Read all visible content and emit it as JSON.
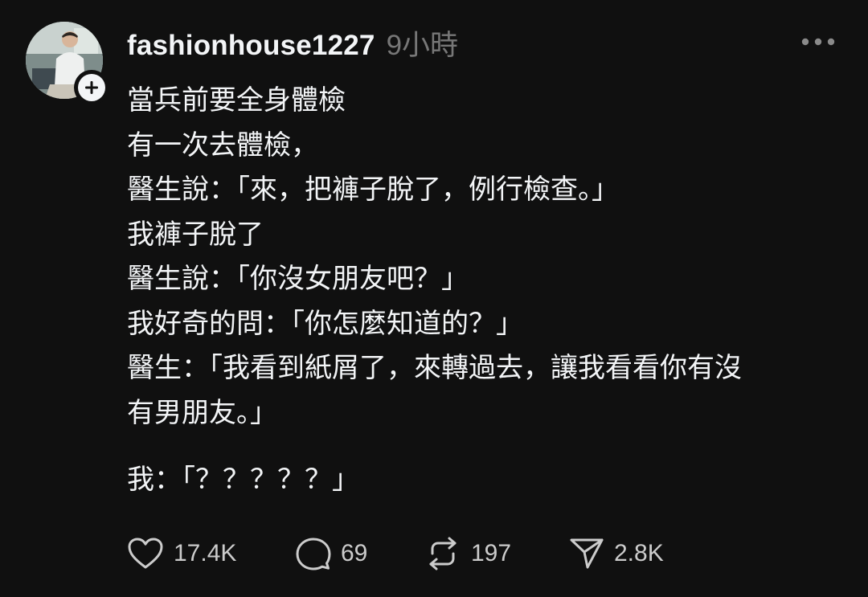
{
  "post": {
    "username": "fashionhouse1227",
    "timestamp": "9小時",
    "lines": [
      "當兵前要全身體檢",
      "有一次去體檢，",
      "醫生說：「來，把褲子脫了，例行檢查。」",
      "我褲子脫了",
      "醫生說：「你沒女朋友吧？」",
      "我好奇的問：「你怎麼知道的？」",
      "醫生：「我看到紙屑了，來轉過去，讓我看看你有沒",
      "有男朋友。」",
      "我：「？？？？？」"
    ]
  },
  "actions": {
    "likes": "17.4K",
    "comments": "69",
    "reposts": "197",
    "shares": "2.8K"
  },
  "icons": {
    "like": "heart-icon",
    "comment": "comment-bubble-icon",
    "repost": "repost-icon",
    "share": "send-icon",
    "more": "more-dots-icon",
    "follow": "plus-icon"
  },
  "colors": {
    "background": "#101010",
    "text": "#f3f5f7",
    "muted": "#777777"
  }
}
